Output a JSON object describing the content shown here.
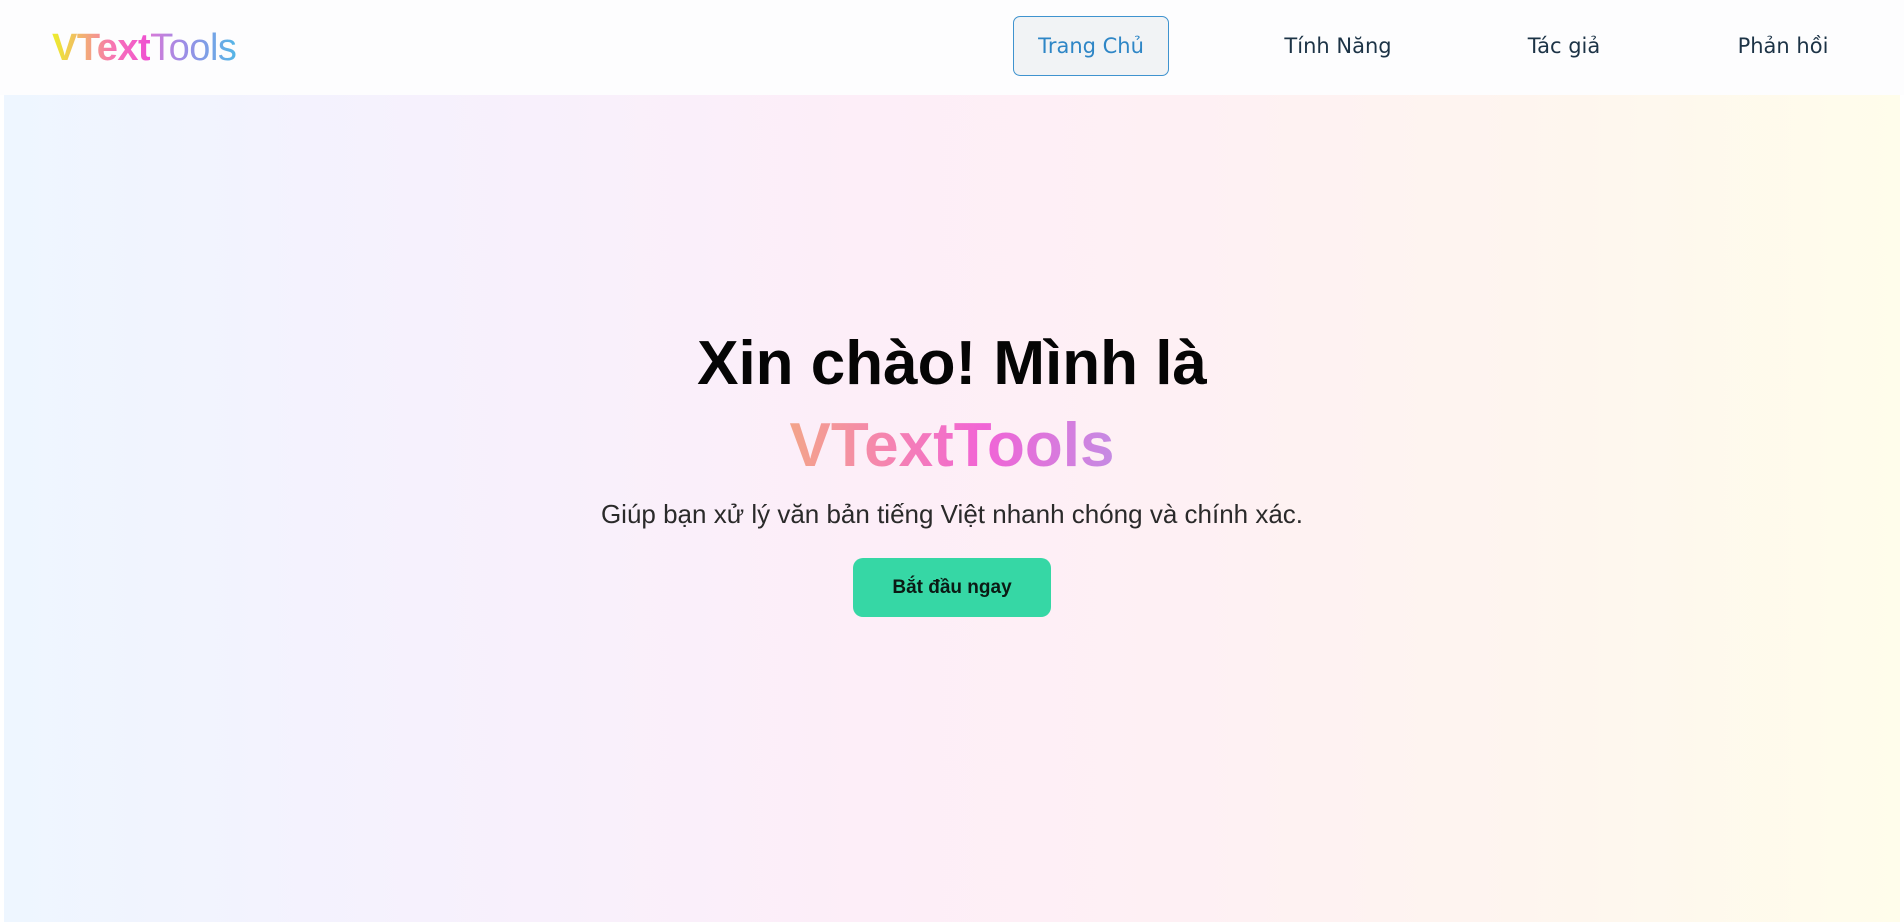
{
  "header": {
    "logo": {
      "strong": "VText",
      "light": "Tools"
    },
    "nav": [
      {
        "label": "Trang Chủ",
        "active": true
      },
      {
        "label": "Tính Năng",
        "active": false
      },
      {
        "label": "Tác giả",
        "active": false
      },
      {
        "label": "Phản hồi",
        "active": false
      }
    ]
  },
  "hero": {
    "title": "Xin chào! Mình là",
    "brand": "VTextTools",
    "subtitle": "Giúp bạn xử lý văn bản tiếng Việt nhanh chóng và chính xác.",
    "cta_label": "Bắt đầu ngay"
  },
  "colors": {
    "accent": "#36d7a5",
    "nav_active": "#2e86c6",
    "nav_text": "#1c3346"
  }
}
